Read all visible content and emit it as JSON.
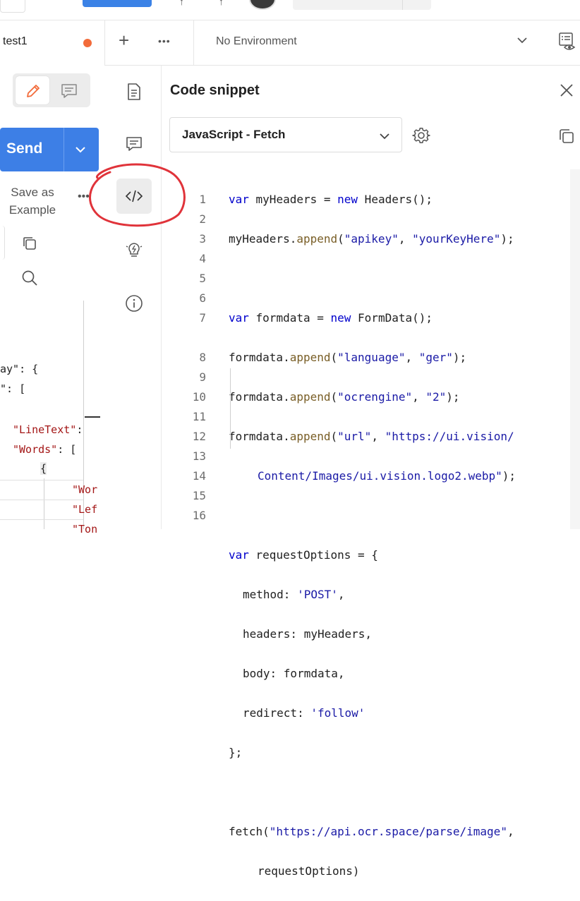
{
  "left_panel": {
    "tab_name": "test1",
    "send_label": "Send",
    "save_example_line1": "Save as",
    "save_example_line2": "Example",
    "more": "•••",
    "json_fragments": [
      {
        "text": "ay\": {",
        "top": 0
      },
      {
        "text": "\": [",
        "top": 0
      }
    ],
    "json_lines": {
      "l1": "ay\": {",
      "l2": "\": [",
      "l3_key": "\"LineText\"",
      "l3_rest": ":",
      "l4_key": "\"Words\"",
      "l4_rest": ": [",
      "l5": "{",
      "l6": "\"Wor",
      "l7": "\"Lef",
      "l8": "\"Ton"
    }
  },
  "header": {
    "new_tab": "+",
    "more": "•••",
    "environment": "No Environment"
  },
  "code_snippet": {
    "title": "Code snippet",
    "language": "JavaScript - Fetch",
    "lines": [
      {
        "n": "1"
      },
      {
        "n": "2"
      },
      {
        "n": "3"
      },
      {
        "n": "4"
      },
      {
        "n": "5"
      },
      {
        "n": "6"
      },
      {
        "n": "7"
      },
      {
        "n": ""
      },
      {
        "n": "8"
      },
      {
        "n": "9"
      },
      {
        "n": "10"
      },
      {
        "n": "11"
      },
      {
        "n": "12"
      },
      {
        "n": "13"
      },
      {
        "n": "14"
      },
      {
        "n": "15"
      },
      {
        "n": "16"
      },
      {
        "n": ""
      }
    ],
    "code": {
      "l1a": "var",
      "l1b": " myHeaders = ",
      "l1c": "new",
      "l1d": " Headers();",
      "l2a": "myHeaders.",
      "l2b": "append",
      "l2c": "(",
      "l2d": "\"apikey\"",
      "l2e": ", ",
      "l2f": "\"yourKeyHere\"",
      "l2g": ");",
      "l4a": "var",
      "l4b": " formdata = ",
      "l4c": "new",
      "l4d": " FormData();",
      "l5a": "formdata.",
      "l5b": "append",
      "l5c": "(",
      "l5d": "\"language\"",
      "l5e": ", ",
      "l5f": "\"ger\"",
      "l5g": ");",
      "l6a": "formdata.",
      "l6b": "append",
      "l6c": "(",
      "l6d": "\"ocrengine\"",
      "l6e": ", ",
      "l6f": "\"2\"",
      "l6g": ");",
      "l7a": "formdata.",
      "l7b": "append",
      "l7c": "(",
      "l7d": "\"url\"",
      "l7e": ", ",
      "l7f": "\"https://ui.vision/",
      "l7w": "Content/Images/ui.vision.logo2.webp\"",
      "l7x": ");",
      "l9a": "var",
      "l9b": " requestOptions = {",
      "l10a": "method: ",
      "l10b": "'POST'",
      "l10c": ",",
      "l11a": "headers: myHeaders,",
      "l12a": "body: formdata,",
      "l13a": "redirect: ",
      "l13b": "'follow'",
      "l14a": "};",
      "l16a": "fetch(",
      "l16b": "\"https://api.ocr.space/parse/image\"",
      "l16c": ",",
      "l16w": "requestOptions)"
    }
  },
  "colors": {
    "send": "#3d7fe6",
    "unsaved_dot": "#f26b3a",
    "annotation": "#e0333a"
  }
}
